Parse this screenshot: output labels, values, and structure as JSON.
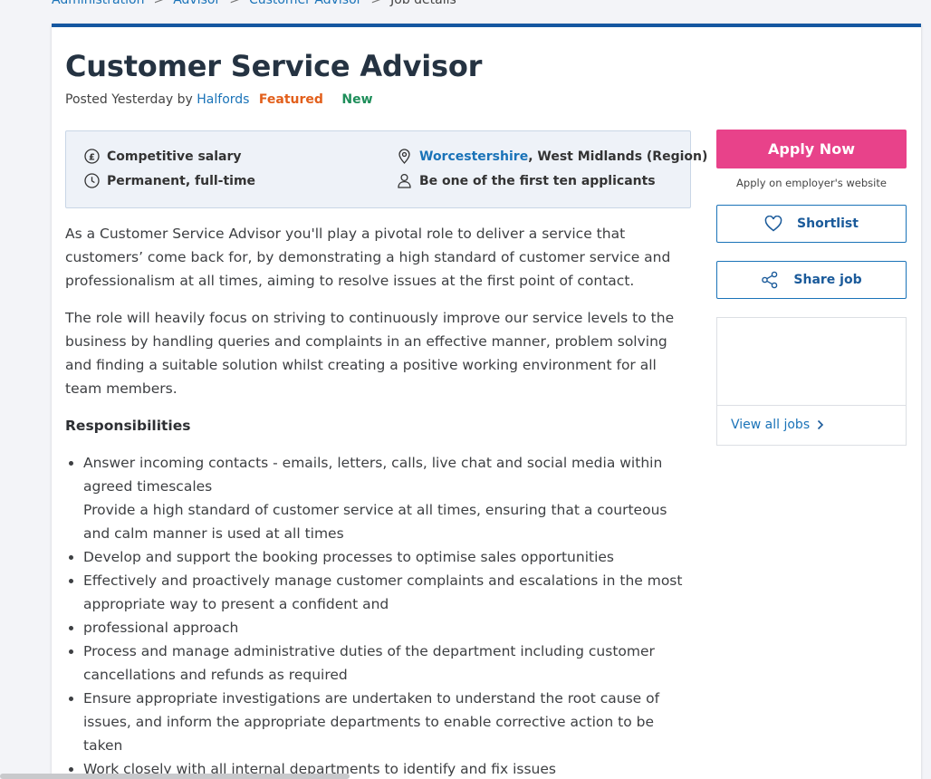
{
  "breadcrumb": {
    "items": [
      "Administration",
      "Advisor",
      "Customer Advisor"
    ],
    "current": "Job details",
    "separator": ">"
  },
  "job": {
    "title": "Customer Service Advisor",
    "posted_prefix": "Posted Yesterday by",
    "author": "Halfords",
    "badge_featured": "Featured",
    "badge_new": "New"
  },
  "summary": {
    "salary": "Competitive salary",
    "type": "Permanent, full-time",
    "location_link": "Worcestershire",
    "location_rest": ", West Midlands (Region)",
    "applicants": "Be one of the first ten applicants"
  },
  "description": {
    "para1": "As a Customer Service Advisor you'll play a pivotal role to deliver a service that customers’ come back for, by demonstrating a high standard of customer service and professionalism at all times, aiming to resolve issues at the first point of contact.",
    "para2": "The role will heavily focus on striving to continuously improve our service levels to the business by handling queries and complaints in an effective manner, problem solving and finding a suitable solution whilst creating a positive working environment for all team members.",
    "responsibilities_heading": "Responsibilities",
    "responsibilities": [
      "Answer incoming contacts - emails, letters, calls, live chat and social media within agreed timescales",
      "Provide a high standard of customer service at all times, ensuring that a courteous and calm manner is used at all times",
      "Develop and support the booking processes to optimise sales opportunities",
      "Effectively and proactively manage customer complaints and escalations in the most appropriate way to present a confident and",
      "professional approach",
      "Process and manage administrative duties of the department including customer cancellations and refunds as required",
      "Ensure appropriate investigations are undertaken to understand the root cause of issues, and inform the appropriate departments to enable corrective action to be taken",
      "Work closely with all internal departments to identify and fix issues"
    ]
  },
  "sidebar": {
    "apply_label": "Apply Now",
    "apply_note": "Apply on employer's website",
    "shortlist_label": "Shortlist",
    "share_label": "Share job",
    "view_all_label": "View all jobs"
  },
  "colors": {
    "apply": "#e8428a",
    "link": "#1a73b8",
    "featured": "#e25f1b",
    "new": "#1e8e5a",
    "card_top_border": "#1557a0"
  },
  "icons": {
    "salary": "pound-icon",
    "type": "clock-icon",
    "location": "location-pin-icon",
    "applicants": "person-icon",
    "shortlist": "heart-icon",
    "share": "share-icon",
    "view_all": "chevron-right-icon"
  }
}
